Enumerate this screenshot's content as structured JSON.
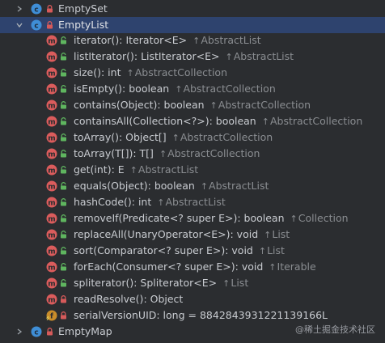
{
  "tree": {
    "empty_set": {
      "label": "EmptySet"
    },
    "empty_list": {
      "label": "EmptyList",
      "members": [
        {
          "signature": "iterator(): Iterator<E>",
          "inherited": "AbstractList",
          "visibility": "public"
        },
        {
          "signature": "listIterator(): ListIterator<E>",
          "inherited": "AbstractList",
          "visibility": "public"
        },
        {
          "signature": "size(): int",
          "inherited": "AbstractCollection",
          "visibility": "public"
        },
        {
          "signature": "isEmpty(): boolean",
          "inherited": "AbstractCollection",
          "visibility": "public"
        },
        {
          "signature": "contains(Object): boolean",
          "inherited": "AbstractCollection",
          "visibility": "public"
        },
        {
          "signature": "containsAll(Collection<?>): boolean",
          "inherited": "AbstractCollection",
          "visibility": "public"
        },
        {
          "signature": "toArray(): Object[]",
          "inherited": "AbstractCollection",
          "visibility": "public"
        },
        {
          "signature": "toArray(T[]): T[]",
          "inherited": "AbstractCollection",
          "visibility": "public"
        },
        {
          "signature": "get(int): E",
          "inherited": "AbstractList",
          "visibility": "public"
        },
        {
          "signature": "equals(Object): boolean",
          "inherited": "AbstractList",
          "visibility": "public"
        },
        {
          "signature": "hashCode(): int",
          "inherited": "AbstractList",
          "visibility": "public"
        },
        {
          "signature": "removeIf(Predicate<? super E>): boolean",
          "inherited": "Collection",
          "visibility": "public"
        },
        {
          "signature": "replaceAll(UnaryOperator<E>): void",
          "inherited": "List",
          "visibility": "public"
        },
        {
          "signature": "sort(Comparator<? super E>): void",
          "inherited": "List",
          "visibility": "public"
        },
        {
          "signature": "forEach(Consumer<? super E>): void",
          "inherited": "Iterable",
          "visibility": "public"
        },
        {
          "signature": "spliterator(): Spliterator<E>",
          "inherited": "List",
          "visibility": "public"
        },
        {
          "signature": "readResolve(): Object",
          "inherited": "",
          "visibility": "private"
        }
      ],
      "field": {
        "signature": "serialVersionUID: long = 8842843931221139166L"
      }
    },
    "empty_map": {
      "label": "EmptyMap"
    }
  },
  "watermark": "@稀土掘金技术社区",
  "colors": {
    "background": "#2b2d30",
    "selection": "#2e436e",
    "class_icon": "#3f8ed6",
    "method_icon": "#db5c5c",
    "field_icon": "#c88c2a",
    "public_icon": "#5fb55f",
    "private_lock": "#d65a5a",
    "inherited_text": "#8a8d91"
  },
  "icons": {
    "class": "class-icon",
    "method": "method-icon",
    "field": "field-icon",
    "public": "public-icon",
    "lock": "lock-icon",
    "chevron_right": "chevron-right-icon",
    "chevron_down": "chevron-down-icon"
  }
}
